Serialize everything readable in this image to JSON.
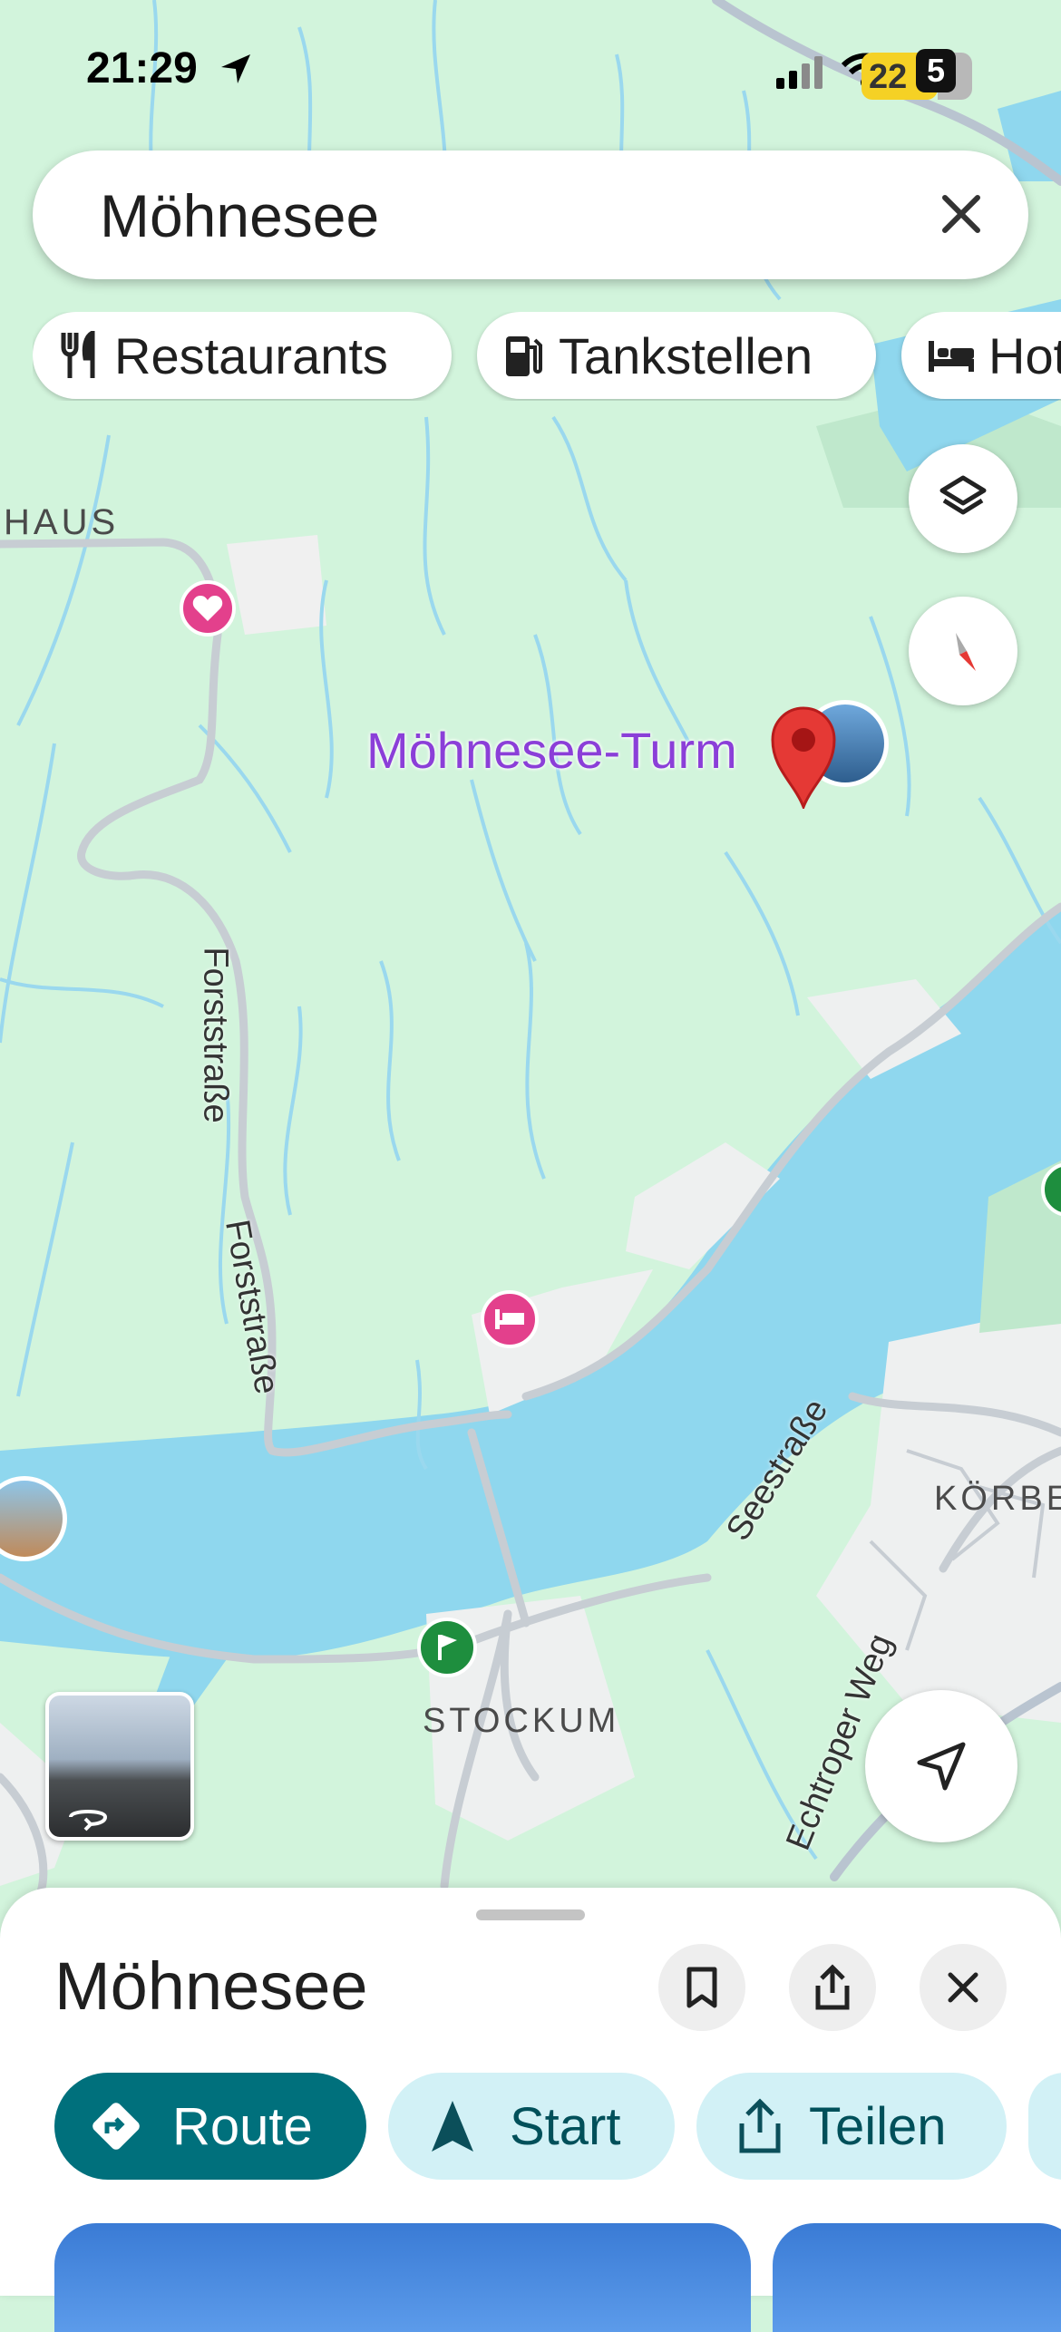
{
  "status_bar": {
    "time": "21:29",
    "battery": "22",
    "notification_count": "5"
  },
  "search": {
    "query": "Möhnesee"
  },
  "chips": [
    {
      "label": "Restaurants",
      "icon": "fork-knife-icon"
    },
    {
      "label": "Tankstellen",
      "icon": "fuel-pump-icon"
    },
    {
      "label": "Hotels",
      "icon": "bed-icon"
    }
  ],
  "map": {
    "place_label": "Möhnesee-Turm",
    "labels": {
      "haus": "HAUS",
      "forststrasse_1": "Forststraße",
      "forststrasse_2": "Forststraße",
      "seestrasse": "Seestraße",
      "koerbecke": "KÖRBE",
      "stockum": "STOCKUM",
      "echtroper": "Echtroper Weg"
    },
    "colors": {
      "land": "#d2f4dc",
      "water": "#8fd7ee",
      "road": "#c7cdd3",
      "stream": "#9ad8ee",
      "pin": "#e53935",
      "place_label": "#8b3fd8"
    }
  },
  "sheet": {
    "title": "Möhnesee",
    "actions": [
      {
        "label": "Route",
        "icon": "directions-icon"
      },
      {
        "label": "Start",
        "icon": "navigation-arrow-icon"
      },
      {
        "label": "Teilen",
        "icon": "share-icon"
      }
    ]
  }
}
